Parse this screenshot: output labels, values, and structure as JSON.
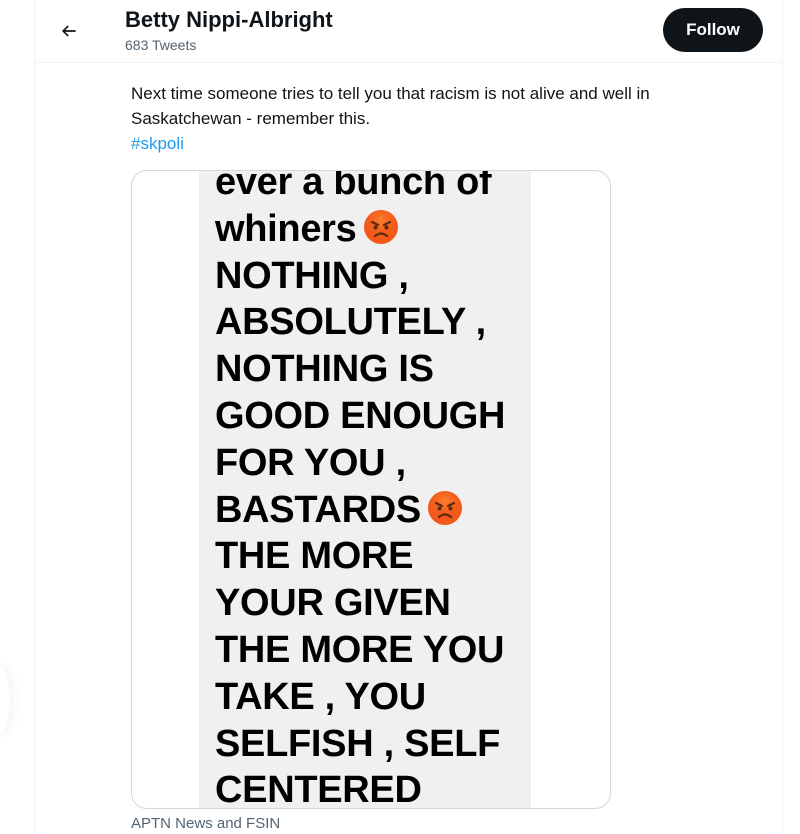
{
  "header": {
    "back_icon": "arrow-left-icon",
    "profile_name": "Betty Nippi-Albright",
    "tweet_count": "683 Tweets",
    "follow_label": "Follow"
  },
  "tweet": {
    "text_line1": "Next time someone tries to tell you that racism is not alive and well in",
    "text_line2": "Saskatchewan - remember this.",
    "hashtag": "#skpoli",
    "media_credit": "APTN News and FSIN"
  },
  "media": {
    "lines": [
      "ever a bunch of",
      "whiners",
      "NOTHING ,",
      "ABSOLUTELY ,",
      "NOTHING IS",
      "GOOD ENOUGH",
      "FOR YOU ,",
      "BASTARDS",
      "THE MORE",
      "YOUR GIVEN",
      "THE MORE YOU",
      "TAKE , YOU",
      "SELFISH , SELF",
      "CENTERED"
    ],
    "emoji_icon": "angry-face-icon"
  },
  "colors": {
    "text": "#0f1419",
    "secondary": "#536471",
    "link": "#1d9bf0",
    "follow_bg": "#0f1419",
    "image_bg": "#f0f0f0"
  }
}
